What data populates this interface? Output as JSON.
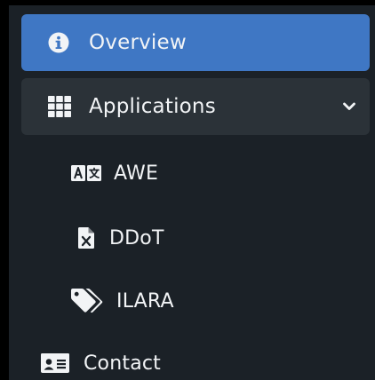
{
  "sidebar": {
    "items": [
      {
        "key": "overview",
        "label": "Overview",
        "icon": "info-circle-icon",
        "active": true
      },
      {
        "key": "applications",
        "label": "Applications",
        "icon": "grid-icon",
        "expanded": true
      },
      {
        "key": "awe",
        "label": "AWE",
        "icon": "translate-icon"
      },
      {
        "key": "ddot",
        "label": "DDoT",
        "icon": "excel-file-icon"
      },
      {
        "key": "ilara",
        "label": "ILARA",
        "icon": "tags-icon"
      },
      {
        "key": "contact",
        "label": "Contact",
        "icon": "id-card-icon"
      }
    ]
  },
  "colors": {
    "active_bg": "#3f77c4",
    "expanded_bg": "#2b3238",
    "sidebar_bg": "#1b2127",
    "text": "#f2f4f6"
  }
}
